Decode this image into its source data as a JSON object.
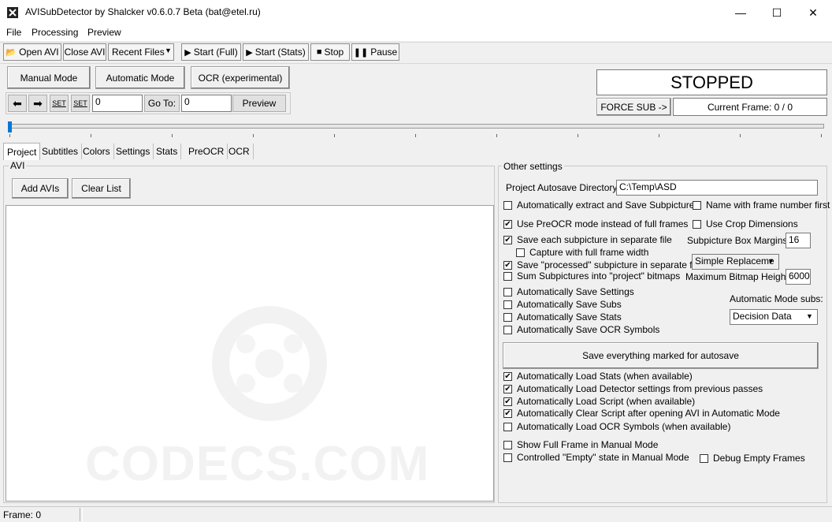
{
  "window": {
    "title": "AVISubDetector by Shalcker v0.6.0.7 Beta (bat@etel.ru)",
    "minimize": "—",
    "maximize": "☐",
    "close": "✕"
  },
  "menu": [
    "File",
    "Processing",
    "Preview"
  ],
  "toolbar": {
    "open_avi": "Open AVI",
    "close_avi": "Close AVI",
    "recent_files": "Recent Files",
    "start_full": "Start (Full)",
    "start_stats": "Start (Stats)",
    "stop": "Stop",
    "pause": "Pause"
  },
  "modes": {
    "manual": "Manual Mode",
    "automatic": "Automatic Mode",
    "ocr": "OCR (experimental)"
  },
  "nav": {
    "set1": "SET",
    "set2": "SET",
    "frame_value": "0",
    "goto_label": "Go To:",
    "goto_value": "0",
    "preview": "Preview"
  },
  "status": {
    "state": "STOPPED",
    "force_sub": "FORCE SUB ->",
    "current_frame": "Current Frame: 0 / 0"
  },
  "tabs": [
    "Project",
    "Subtitles",
    "Colors",
    "Settings",
    "Stats",
    "PreOCR",
    "OCR"
  ],
  "avi_group": {
    "label": "AVI",
    "add_avis": "Add AVIs",
    "clear_list": "Clear List"
  },
  "watermark": "CODECS.COM",
  "other": {
    "label": "Other settings",
    "autosave_dir_label": "Project Autosave Directory:",
    "autosave_dir_value": "C:\\Temp\\ASD",
    "auto_extract": "Automatically extract and Save Subpictures",
    "name_frame_first": "Name with frame number first",
    "use_preocr": "Use PreOCR mode instead of full frames",
    "use_crop": "Use Crop Dimensions",
    "save_each": "Save each subpicture in separate file",
    "box_margins_label": "Subpicture Box Margins:",
    "box_margins_value": "16",
    "capture_full_width": "Capture with full frame width",
    "save_processed": "Save \"processed\" subpicture in separate file",
    "replace_select": "Simple Replaceme",
    "sum_subpictures": "Sum Subpictures into \"project\" bitmaps",
    "max_bitmap_label": "Maximum Bitmap Height:",
    "max_bitmap_value": "6000",
    "auto_save_settings": "Automatically Save Settings",
    "auto_mode_subs_label": "Automatic Mode subs:",
    "auto_save_subs": "Automatically Save Subs",
    "auto_mode_select": "Decision Data",
    "auto_save_stats": "Automatically Save Stats",
    "auto_save_ocr": "Automatically Save OCR Symbols",
    "save_everything": "Save everything marked for autosave",
    "auto_load_stats": "Automatically Load Stats (when available)",
    "auto_load_detector": "Automatically Load Detector settings from previous passes",
    "auto_load_script": "Automatically Load Script (when available)",
    "auto_clear_script": "Automatically Clear Script after opening AVI in Automatic Mode",
    "auto_load_ocr": "Automatically Load OCR Symbols (when available)",
    "show_full_frame": "Show Full Frame in Manual Mode",
    "controlled_empty": "Controlled \"Empty\" state in Manual Mode",
    "debug_empty": "Debug Empty Frames"
  },
  "checks": {
    "auto_extract": false,
    "name_frame_first": false,
    "use_preocr": true,
    "use_crop": false,
    "save_each": true,
    "capture_full_width": false,
    "save_processed": true,
    "sum_subpictures": false,
    "auto_save_settings": false,
    "auto_save_subs": false,
    "auto_save_stats": false,
    "auto_save_ocr": false,
    "auto_load_stats": true,
    "auto_load_detector": true,
    "auto_load_script": true,
    "auto_clear_script": true,
    "auto_load_ocr": false,
    "show_full_frame": false,
    "controlled_empty": false,
    "debug_empty": false
  },
  "statusbar": {
    "frame": "Frame: 0"
  }
}
